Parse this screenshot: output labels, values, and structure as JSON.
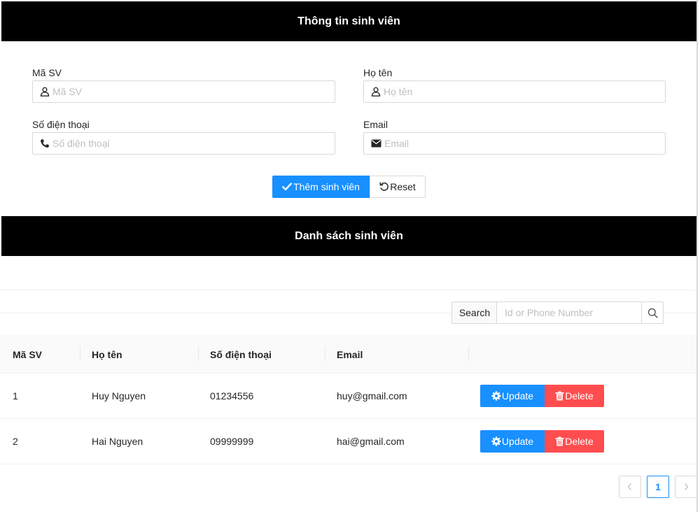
{
  "form_section": {
    "title": "Thông tin sinh viên",
    "fields": [
      {
        "label": "Mã SV",
        "placeholder": "Mã SV",
        "value": "",
        "icon": "user-icon"
      },
      {
        "label": "Họ tên",
        "placeholder": "Họ tên",
        "value": "",
        "icon": "user-icon"
      },
      {
        "label": "Số điện thoại",
        "placeholder": "Số điện thoại",
        "value": "",
        "icon": "phone-icon"
      },
      {
        "label": "Email",
        "placeholder": "Email",
        "value": "",
        "icon": "mail-icon"
      }
    ],
    "add_button": "Thêm sinh viên",
    "reset_button": "Reset"
  },
  "list_section": {
    "title": "Danh sách sinh viên",
    "search_label": "Search",
    "search_placeholder": "Id or Phone Number",
    "columns": [
      "Mã SV",
      "Họ tên",
      "Số điện thoại",
      "Email"
    ],
    "rows": [
      {
        "id": "1",
        "name": "Huy Nguyen",
        "phone": "01234556",
        "email": "huy@gmail.com"
      },
      {
        "id": "2",
        "name": "Hai Nguyen",
        "phone": "09999999",
        "email": "hai@gmail.com"
      }
    ],
    "update_label": "Update",
    "delete_label": "Delete",
    "pagination": {
      "current_page": "1"
    }
  },
  "colors": {
    "primary": "#1890ff",
    "danger": "#ff4d4f",
    "header_bg": "#000000"
  }
}
